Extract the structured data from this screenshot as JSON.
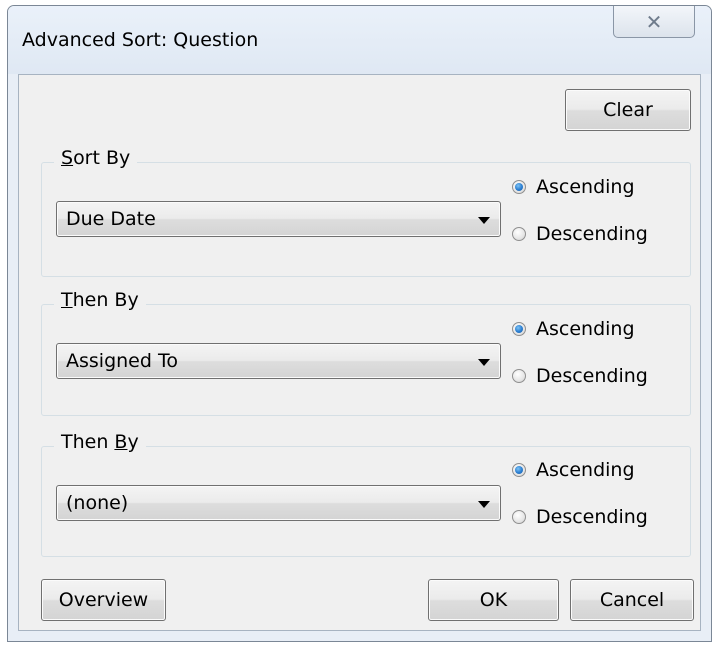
{
  "window": {
    "title": "Advanced Sort: Question",
    "close_glyph": "✕"
  },
  "toolbar": {
    "clear_label": "Clear"
  },
  "groups": [
    {
      "label_prefix": "",
      "label_mnemonic": "S",
      "label_suffix": "ort By",
      "select_value": "Due Date",
      "ascending_label": "Ascending",
      "descending_label": "Descending",
      "selected_order": "Ascending"
    },
    {
      "label_prefix": "",
      "label_mnemonic": "T",
      "label_suffix": "hen By",
      "select_value": "Assigned To",
      "ascending_label": "Ascending",
      "descending_label": "Descending",
      "selected_order": "Ascending"
    },
    {
      "label_prefix": "Then ",
      "label_mnemonic": "B",
      "label_suffix": "y",
      "select_value": "(none)",
      "ascending_label": "Ascending",
      "descending_label": "Descending",
      "selected_order": "Ascending"
    }
  ],
  "footer": {
    "overview_label": "Overview",
    "ok_label": "OK",
    "cancel_label": "Cancel"
  }
}
